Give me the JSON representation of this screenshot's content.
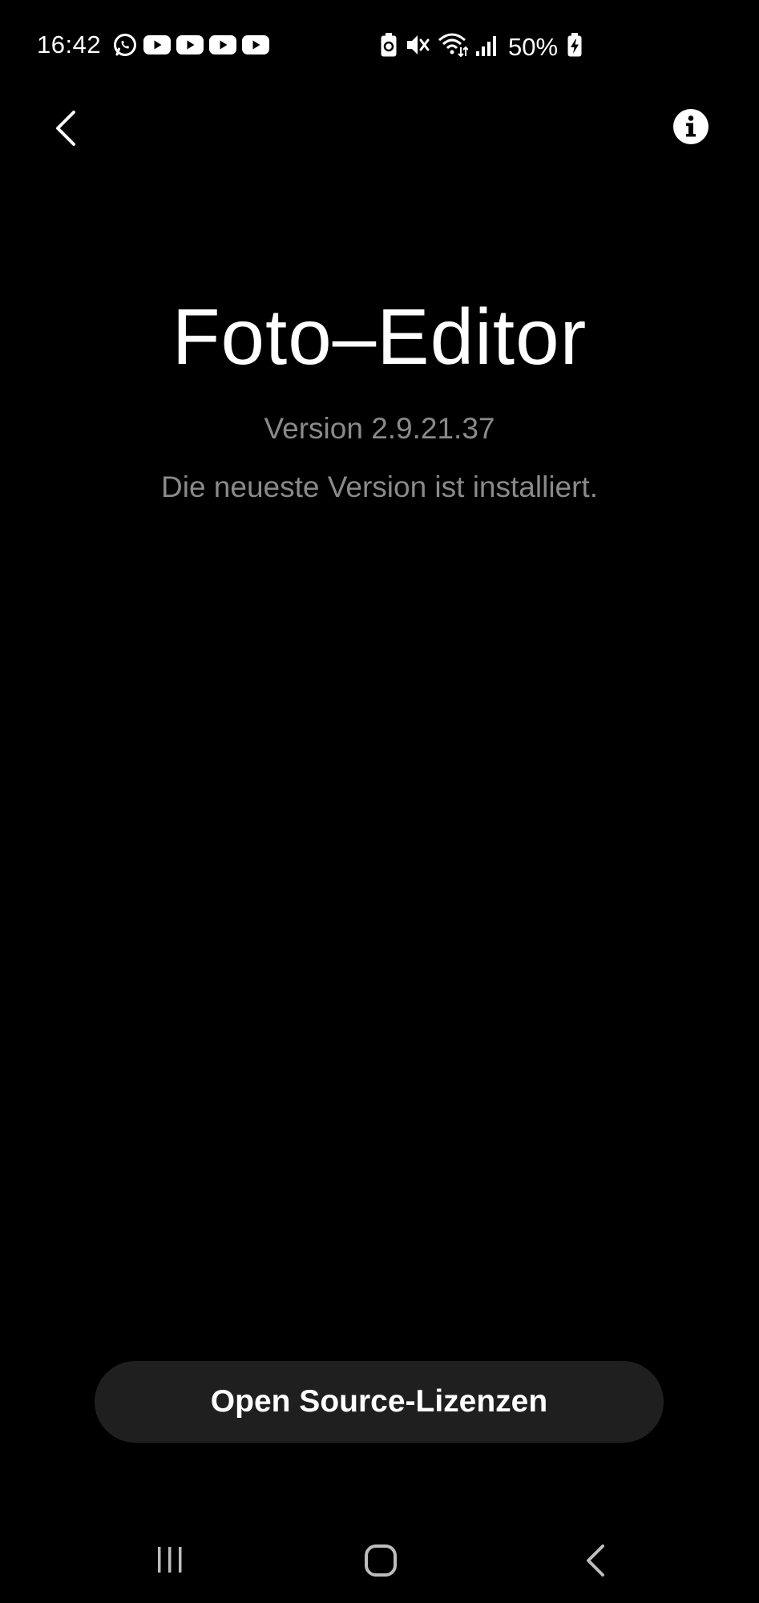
{
  "status_bar": {
    "time": "16:42",
    "battery": "50%",
    "notification_icons": [
      "whatsapp-icon",
      "youtube-icon",
      "youtube-icon",
      "youtube-icon",
      "youtube-icon"
    ],
    "system_icons": [
      "battery-saver-icon",
      "mute-icon",
      "wifi-icon",
      "signal-icon",
      "battery-charging-icon"
    ]
  },
  "top_bar": {
    "back_icon": "chevron-left-icon",
    "info_icon": "info-icon"
  },
  "app": {
    "title": "Foto–Editor",
    "version": "Version 2.9.21.37",
    "update_status": "Die neueste Version ist installiert."
  },
  "actions": {
    "licenses_label": "Open Source-Lizenzen"
  },
  "nav_bar": {
    "icons": [
      "recents-icon",
      "home-icon",
      "back-icon"
    ]
  },
  "colors": {
    "background": "#000000",
    "text_primary": "#ffffff",
    "text_secondary": "#8a8a8a",
    "button_background": "#1f1f1f"
  }
}
